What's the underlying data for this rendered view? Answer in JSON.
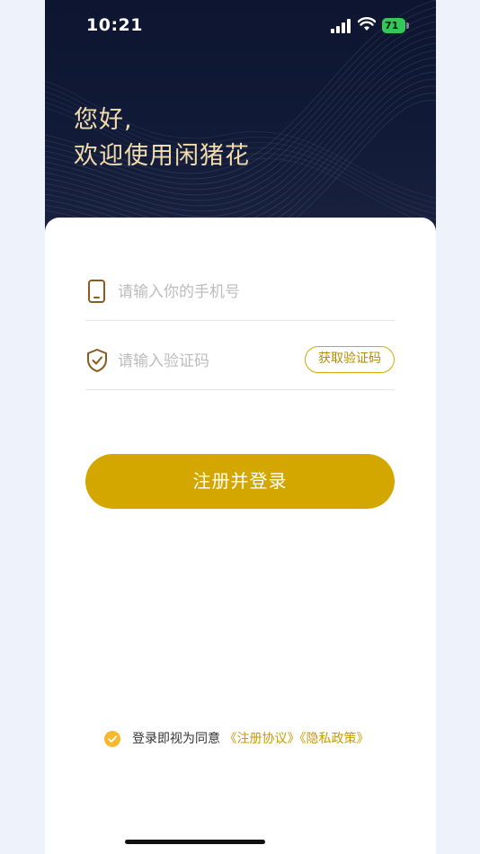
{
  "status_bar": {
    "time": "10:21",
    "battery": "71"
  },
  "greeting": {
    "line1": "您好,",
    "line2": "欢迎使用闲猪花"
  },
  "form": {
    "phone_placeholder": "请输入你的手机号",
    "code_placeholder": "请输入验证码",
    "get_code_label": "获取验证码",
    "submit_label": "注册并登录"
  },
  "agreement": {
    "checked": true,
    "prefix": "登录即视为同意",
    "terms_link": "《注册协议》",
    "privacy_link": "《隐私政策》"
  },
  "icons": {
    "phone": "phone-icon",
    "shield": "shield-check-icon",
    "check": "check-circle-icon"
  },
  "colors": {
    "accent": "#d4a700",
    "hero_bg": "#0d1530",
    "greeting_text": "#f1dcae",
    "icon_brown": "#8a5a1f"
  }
}
